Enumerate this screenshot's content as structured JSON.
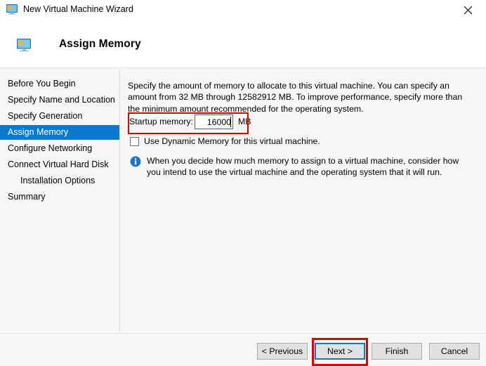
{
  "window": {
    "title": "New Virtual Machine Wizard",
    "icon": "vm-monitor-icon",
    "close_label": "✕"
  },
  "header": {
    "title": "Assign Memory",
    "icon": "vm-monitor-icon"
  },
  "sidebar": {
    "items": [
      {
        "label": "Before You Begin",
        "active": false,
        "sub": false
      },
      {
        "label": "Specify Name and Location",
        "active": false,
        "sub": false
      },
      {
        "label": "Specify Generation",
        "active": false,
        "sub": false
      },
      {
        "label": "Assign Memory",
        "active": true,
        "sub": false
      },
      {
        "label": "Configure Networking",
        "active": false,
        "sub": false
      },
      {
        "label": "Connect Virtual Hard Disk",
        "active": false,
        "sub": false
      },
      {
        "label": "Installation Options",
        "active": false,
        "sub": true
      },
      {
        "label": "Summary",
        "active": false,
        "sub": false
      }
    ]
  },
  "main": {
    "description": "Specify the amount of memory to allocate to this virtual machine. You can specify an amount from 32 MB through 12582912 MB. To improve performance, specify more than the minimum amount recommended for the operating system.",
    "startup_memory": {
      "label": "Startup memory:",
      "value": "16000",
      "placeholder": "",
      "unit": "MB"
    },
    "dynamic_memory": {
      "label": "Use Dynamic Memory for this virtual machine.",
      "checked": false
    },
    "info": {
      "icon": "info-icon",
      "text": "When you decide how much memory to assign to a virtual machine, consider how you intend to use the virtual machine and the operating system that it will run."
    }
  },
  "footer": {
    "buttons": [
      {
        "label": "< Previous",
        "default": false
      },
      {
        "label": "Next >",
        "default": true
      },
      {
        "label": "Finish",
        "default": false
      },
      {
        "label": "Cancel",
        "default": false
      }
    ]
  },
  "annotations": {
    "highlight_color": "#e00000",
    "accent_color": "#0a7ad1",
    "targets": [
      "startup-memory-row",
      "next-button"
    ]
  }
}
